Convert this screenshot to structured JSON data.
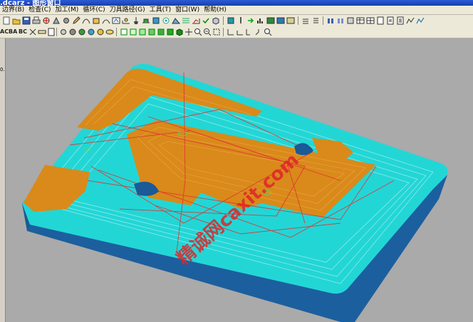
{
  "window": {
    "title": ".dcarz - 图形窗口"
  },
  "menu": [
    "边界(B)",
    "检查(C)",
    "加工(M)",
    "循环(C)",
    "刀具路径(G)",
    "工具(T)",
    "窗口(W)",
    "帮助(H)"
  ],
  "toolbar2_text": {
    "ac": "AC",
    "ba": "BA",
    "bc": "BC"
  },
  "left_strip_label": "0.",
  "watermark": "精诚网caxit.com",
  "colors": {
    "viewport_bg": "#aaaaaa",
    "part_side": "#1f66a6",
    "part_top": "#22d8d8",
    "pocket_floor": "#d98a1a",
    "toolpath": "#e23131"
  }
}
